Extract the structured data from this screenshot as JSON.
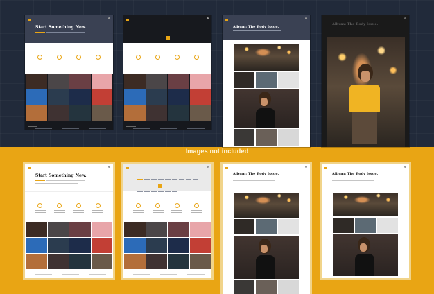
{
  "banner": {
    "text": "Images not included"
  },
  "mocks": {
    "start_title": "Start Something New.",
    "album_title": "Album: The Body Issue."
  },
  "colors": {
    "accent": "#e9a514",
    "dark_background": "#212a3a",
    "light_background": "#ffffff"
  }
}
